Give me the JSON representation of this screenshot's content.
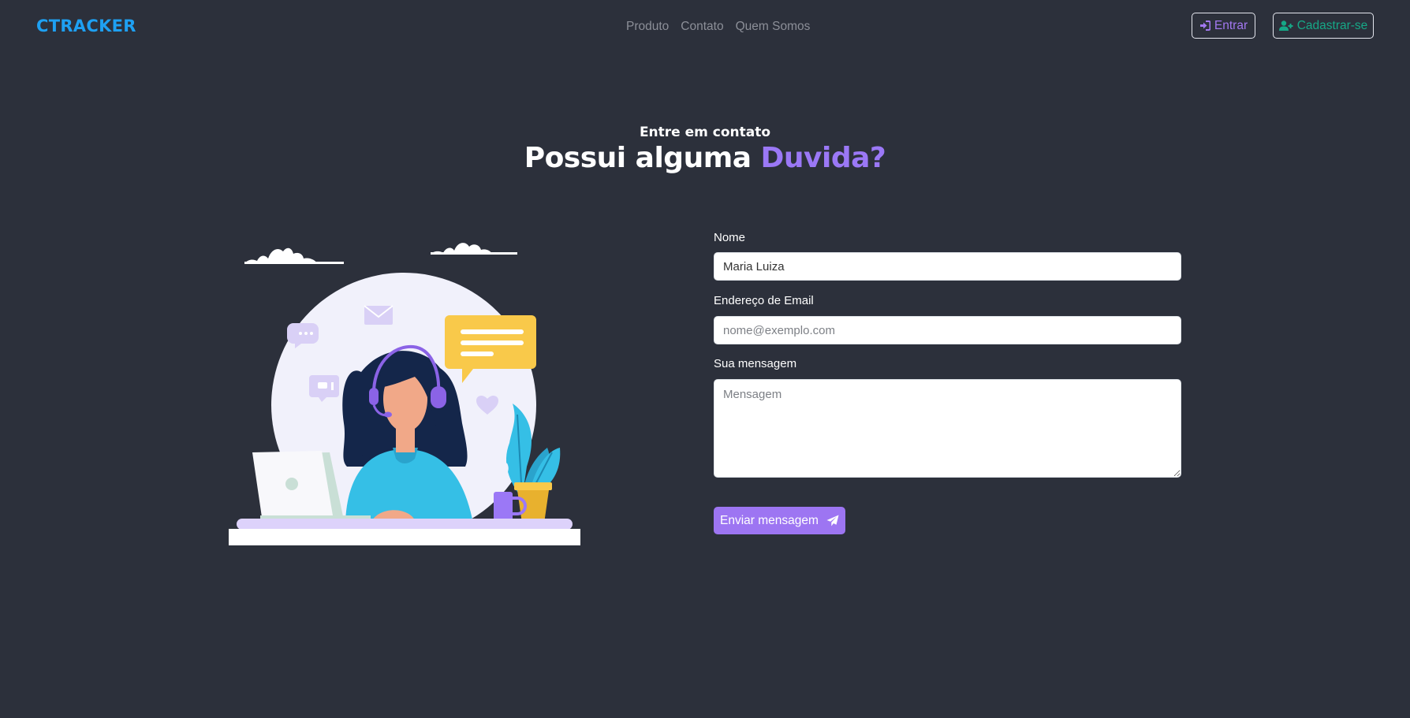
{
  "header": {
    "brand": "CTRACKER",
    "nav": [
      "Produto",
      "Contato",
      "Quem Somos"
    ],
    "login_label": "Entrar",
    "signup_label": "Cadastrar-se"
  },
  "hero": {
    "eyebrow": "Entre em contato",
    "headline_prefix": "Possui alguma",
    "headline_accent": "Duvida?"
  },
  "form": {
    "name_label": "Nome",
    "name_value": "Maria Luiza",
    "email_label": "Endereço de Email",
    "email_placeholder": "nome@exemplo.com",
    "message_label": "Sua mensagem",
    "message_placeholder": "Mensagem",
    "submit_label": "Enviar mensagem"
  },
  "colors": {
    "background": "#2c303b",
    "brand": "#1ea0f2",
    "accent": "#9b78f6",
    "signup": "#16a887"
  },
  "icons": {
    "login": "sign-in-icon",
    "signup": "user-plus-icon",
    "submit": "paper-plane-icon"
  }
}
